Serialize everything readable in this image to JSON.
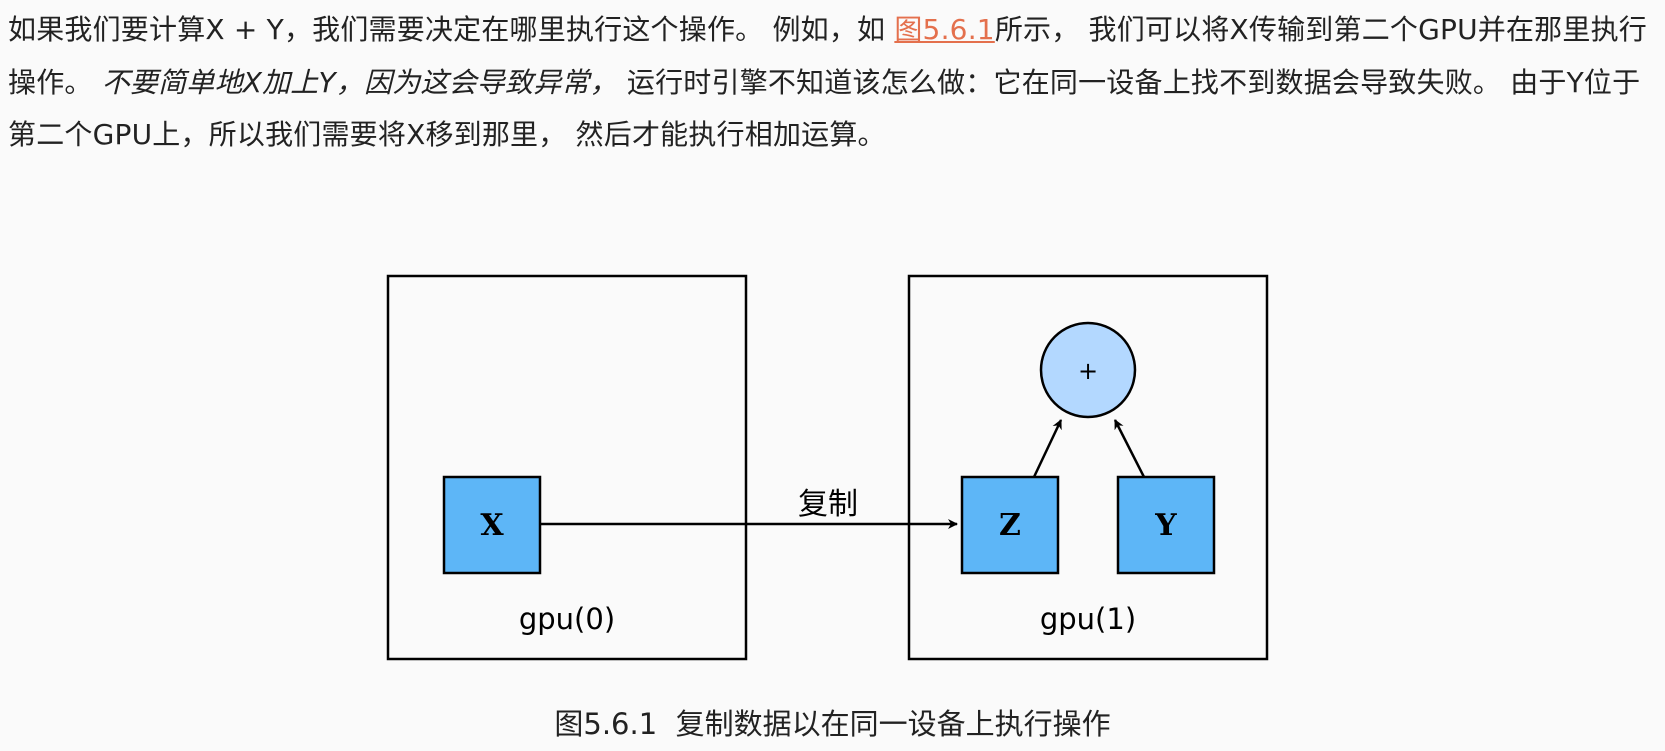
{
  "paragraph": {
    "segment_1": "如果我们要计算X + Y，我们需要决定在哪里执行这个操作。 例如，如 ",
    "figure_link": "图5.6.1",
    "segment_2": "所示， 我们可以将X传输到第二个GPU并在那里执行操作。 ",
    "emphasis": "不要简单地X加上Y，因为这会导致异常，",
    "segment_3": " 运行时引擎不知道该怎么做：它在同一设备上找不到数据会导致失败。 由于Y位于第二个GPU上，所以我们需要将X移到那里， 然后才能执行相加运算。"
  },
  "diagram": {
    "devices": [
      {
        "label": "gpu(0)"
      },
      {
        "label": "gpu(1)"
      }
    ],
    "nodes": {
      "x": "X",
      "z": "Z",
      "y": "Y",
      "op": "+"
    },
    "edge_label": "复制",
    "colors": {
      "node_fill": "#5db6f7",
      "op_fill": "#b3d8ff",
      "stroke": "#000000",
      "link": "#e4704d"
    }
  },
  "caption": {
    "number": "图5.6.1",
    "text": "复制数据以在同一设备上执行操作"
  }
}
